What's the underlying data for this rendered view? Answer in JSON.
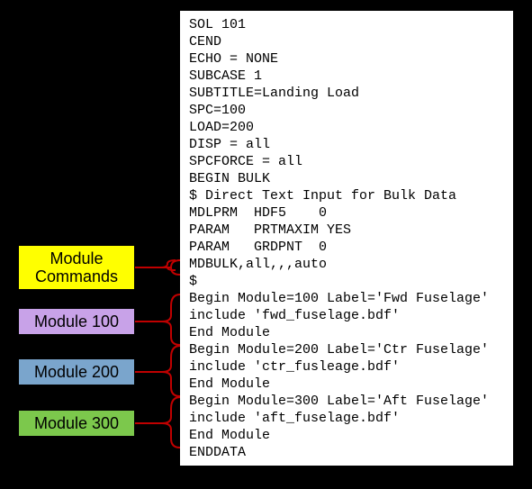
{
  "labels": {
    "commands_line1": "Module",
    "commands_line2": "Commands",
    "m100": "Module 100",
    "m200": "Module 200",
    "m300": "Module 300"
  },
  "code": {
    "l1": "SOL 101",
    "l2": "CEND",
    "l3": "ECHO = NONE",
    "l4": "SUBCASE 1",
    "l5": "SUBTITLE=Landing Load",
    "l6": "SPC=100",
    "l7": "LOAD=200",
    "l8": "DISP = all",
    "l9": "SPCFORCE = all",
    "l10": "BEGIN BULK",
    "l11": "$ Direct Text Input for Bulk Data",
    "l12": "MDLPRM  HDF5    0",
    "l13": "PARAM   PRTMAXIM YES",
    "l14": "PARAM   GRDPNT  0",
    "l15": "MDBULK,all,,,auto",
    "l16": "$",
    "l17": "Begin Module=100 Label='Fwd Fuselage'",
    "l18": "include 'fwd_fuselage.bdf'",
    "l19": "End Module",
    "l20": "Begin Module=200 Label='Ctr Fuselage'",
    "l21": "include 'ctr_fusleage.bdf'",
    "l22": "End Module",
    "l23": "Begin Module=300 Label='Aft Fuselage'",
    "l24": "include 'aft_fuselage.bdf'",
    "l25": "End Module",
    "l26": "ENDDATA"
  }
}
